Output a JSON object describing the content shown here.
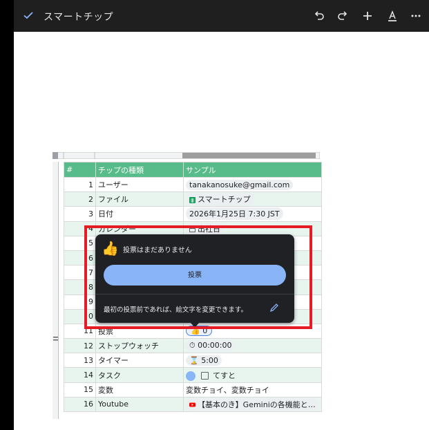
{
  "toolbar": {
    "title": "スマートチップ"
  },
  "table": {
    "headers": [
      "#",
      "チップの種類",
      "サンプル"
    ],
    "rows": [
      {
        "num": "1",
        "type": "ユーザー",
        "sample": "tanakanosuke@gmail.com"
      },
      {
        "num": "2",
        "type": "ファイル",
        "sample": "スマートチップ"
      },
      {
        "num": "3",
        "type": "日付",
        "sample": "2026年1月25日 7:30 JST"
      },
      {
        "num": "4",
        "type": "カレンダー",
        "sample": "出社日"
      },
      {
        "num": "5",
        "type": "",
        "sample": ""
      },
      {
        "num": "6",
        "type": "",
        "sample": ""
      },
      {
        "num": "7",
        "type": "",
        "sample": ""
      },
      {
        "num": "8",
        "type": "",
        "sample": ""
      },
      {
        "num": "9",
        "type": "",
        "sample": ""
      },
      {
        "num": "0",
        "type": "",
        "sample": ""
      },
      {
        "num": "11",
        "type": "投票",
        "sample": "0"
      },
      {
        "num": "12",
        "type": "ストップウォッチ",
        "sample": "00:00:00"
      },
      {
        "num": "13",
        "type": "タイマー",
        "sample": "5:00"
      },
      {
        "num": "14",
        "type": "タスク",
        "sample": "てすと"
      },
      {
        "num": "15",
        "type": "変数",
        "sample": "変数チョイ、変数チョイ"
      },
      {
        "num": "16",
        "type": "Youtube",
        "sample": "【基本のき】Geminiの各機能と…"
      }
    ]
  },
  "popup": {
    "no_votes": "投票はまだありません",
    "vote_button": "投票",
    "note": "最初の投票前であれば、絵文字を変更できます。"
  },
  "colors": {
    "header_green": "#57bb8a",
    "alt_row": "#e7f5ee",
    "highlight_red": "#e51c23",
    "popup_bg": "#202124",
    "button_blue": "#8ab4f8"
  }
}
